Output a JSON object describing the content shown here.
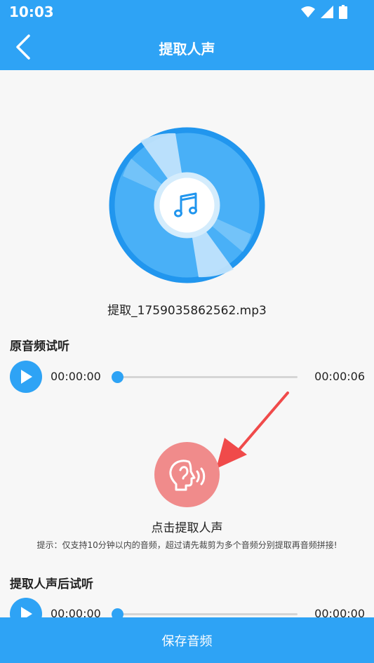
{
  "status_bar": {
    "time": "10:03"
  },
  "header": {
    "title": "提取人声"
  },
  "file": {
    "name": "提取_1759035862562.mp3"
  },
  "original": {
    "title": "原音频试听",
    "current_time": "00:00:00",
    "total_time": "00:00:06",
    "progress": 0
  },
  "extract": {
    "label": "点击提取人声",
    "hint": "提示：仅支持10分钟以内的音频，超过请先裁剪为多个音频分别提取再音频拼接!"
  },
  "extracted": {
    "title": "提取人声后试听",
    "current_time": "00:00:00",
    "total_time": "00:00:00",
    "progress": 0
  },
  "footer": {
    "save_label": "保存音频"
  },
  "colors": {
    "primary": "#2ea3f5",
    "extract_button": "#f08b8b",
    "arrow": "#f04a4a"
  }
}
